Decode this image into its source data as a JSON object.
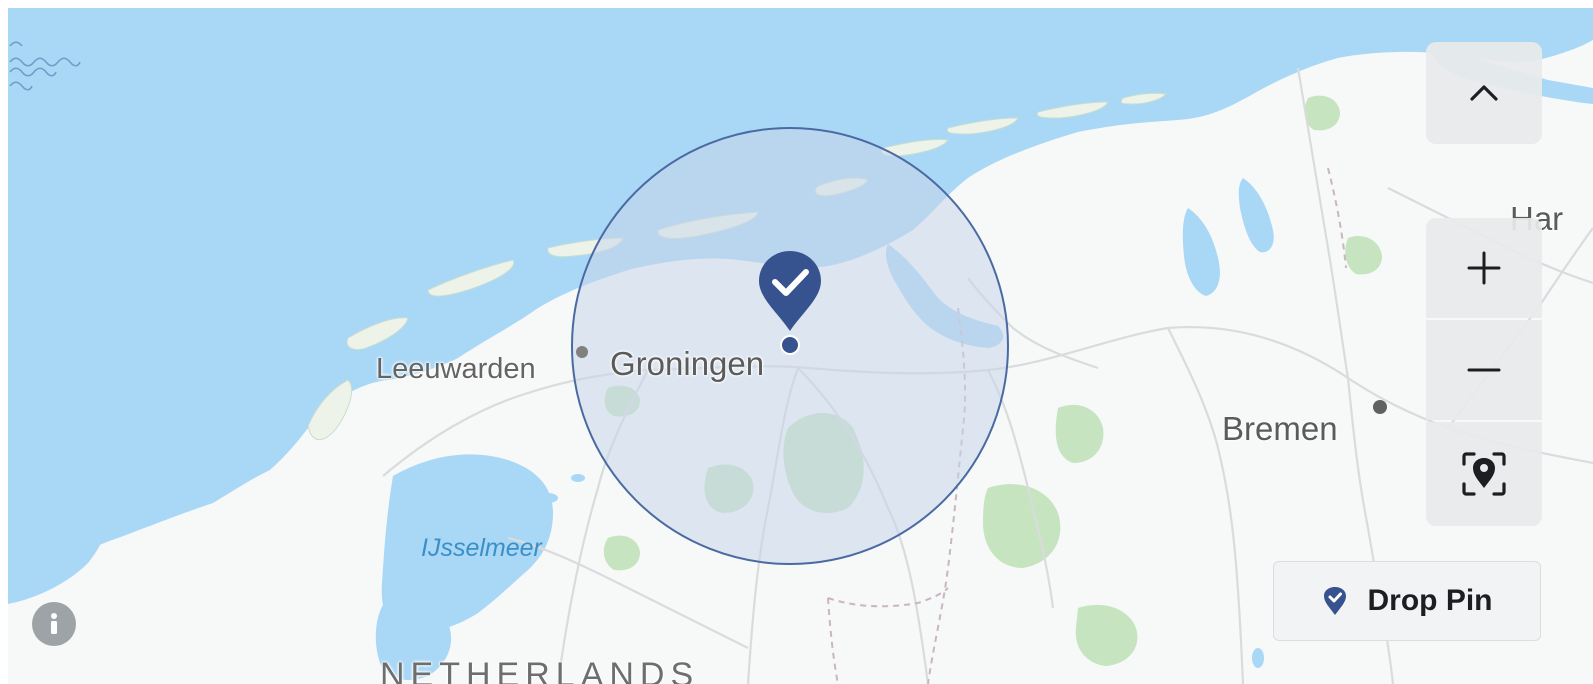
{
  "map": {
    "labels": {
      "leeuwarden": "Leeuwarden",
      "groningen": "Groningen",
      "bremen": "Bremen",
      "hamburg_partial": "Har",
      "ijsselmeer": "IJsselmeer",
      "country": "NETHERLANDS"
    },
    "selected_location": "Groningen",
    "colors": {
      "water": "#a9d8f6",
      "land": "#f7f8f8",
      "radius_fill": "#c9d6ea",
      "radius_stroke": "#4a6aa3",
      "pin": "#37538f",
      "forest": "#b7dcb2"
    }
  },
  "controls": {
    "collapse_icon": "chevron-up-icon",
    "zoom_in_icon": "plus-icon",
    "zoom_out_icon": "minus-icon",
    "recenter_icon": "locate-pin-icon",
    "info_icon": "info-icon"
  },
  "drop_pin": {
    "label": "Drop Pin",
    "icon": "check-pin-icon"
  }
}
